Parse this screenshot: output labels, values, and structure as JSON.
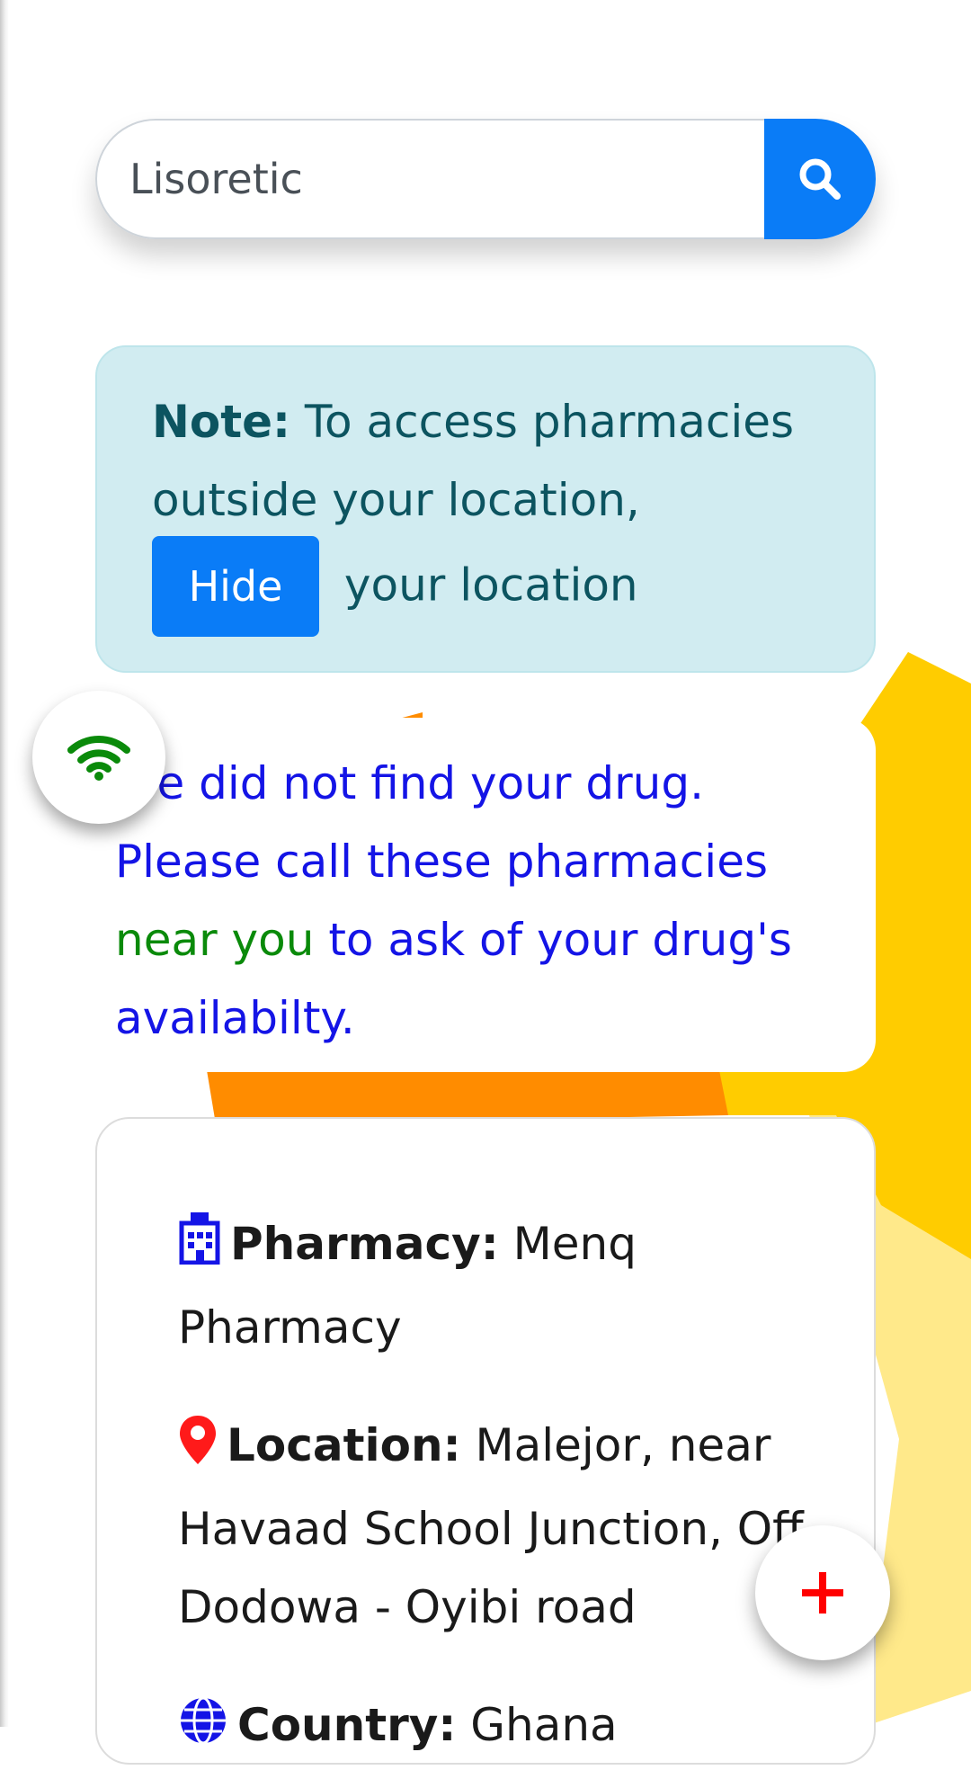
{
  "search": {
    "value": "Lisoretic",
    "icon": "search-icon"
  },
  "note": {
    "label": "Note:",
    "text": "To access pharmacies outside your location,",
    "hide_button": "Hide",
    "suffix": "your location"
  },
  "message": {
    "part1": "We did not find your drug. Please call these pharmacies",
    "highlight": "near you",
    "part2": "to ask of your drug's availabilty."
  },
  "wifi_fab": {
    "icon": "wifi-icon",
    "color": "#0a8a0a"
  },
  "pharmacy": {
    "name_label": "Pharmacy:",
    "name_value": "Menq Pharmacy",
    "location_label": "Location:",
    "location_value": "Malejor, near Havaad School Junction, Off Dodowa - Oyibi road",
    "country_label": "Country:",
    "country_value": "Ghana"
  },
  "add_fab": {
    "icon": "plus-icon",
    "color": "#ff0000"
  },
  "colors": {
    "primary": "#0a7cf7",
    "note_bg": "#d1ecf1",
    "message_text": "#1414e6",
    "accent_yellow": "#ffcc00",
    "accent_orange": "#ff8c00"
  }
}
